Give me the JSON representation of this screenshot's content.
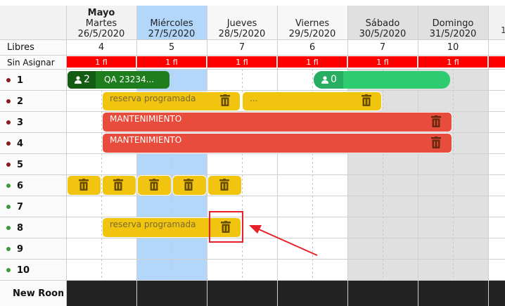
{
  "header": {
    "month": "Mayo",
    "days": [
      {
        "name": "Martes",
        "date": "26/5/2020"
      },
      {
        "name": "Miércoles",
        "date": "27/5/2020"
      },
      {
        "name": "Jueves",
        "date": "28/5/2020"
      },
      {
        "name": "Viernes",
        "date": "29/5/2020"
      },
      {
        "name": "Sábado",
        "date": "30/5/2020"
      },
      {
        "name": "Domingo",
        "date": "31/5/2020"
      }
    ],
    "next_day_partial": "1"
  },
  "libres": {
    "label": "Libres",
    "values": [
      "4",
      "5",
      "7",
      "6",
      "7",
      "10"
    ]
  },
  "sin_asignar": {
    "label": "Sin Asignar",
    "values": [
      "1 fl",
      "1 fl",
      "1 fl",
      "1 fl",
      "1 fl",
      "1 fl"
    ]
  },
  "rooms": [
    {
      "label": "1",
      "status": "#8b1a1a"
    },
    {
      "label": "2",
      "status": "#8b1a1a"
    },
    {
      "label": "3",
      "status": "#8b1a1a"
    },
    {
      "label": "4",
      "status": "#8b1a1a"
    },
    {
      "label": "5",
      "status": "#8b1a1a"
    },
    {
      "label": "6",
      "status": "#3a9a3a"
    },
    {
      "label": "7",
      "status": "#3a9a3a"
    },
    {
      "label": "8",
      "status": "#3a9a3a"
    },
    {
      "label": "9",
      "status": "#3a9a3a"
    },
    {
      "label": "10",
      "status": "#3a9a3a"
    },
    {
      "label": "New Room",
      "status": "#8b1a1a"
    }
  ],
  "bookings": {
    "room1_a": {
      "guests": "2",
      "text": "QA 23234..."
    },
    "room1_b": {
      "guests": "0"
    },
    "room2_a": {
      "text": "reserva programada"
    },
    "room2_b": {
      "text": "..."
    },
    "room3": {
      "text": "MANTENIMIENTO"
    },
    "room4": {
      "text": "MANTENIMIENTO"
    },
    "room8": {
      "text": "reserva programada"
    }
  },
  "colors": {
    "yellow": "#f1c40f",
    "red": "#e74c3c",
    "green_dark": "#1e7e1e",
    "green_light": "#2ecc71",
    "highlight": "#b3d7fb",
    "weekend": "#e0e0e0",
    "annotation": "#e8202a"
  },
  "icons": {
    "trash": "trash-icon",
    "person": "person-icon"
  }
}
